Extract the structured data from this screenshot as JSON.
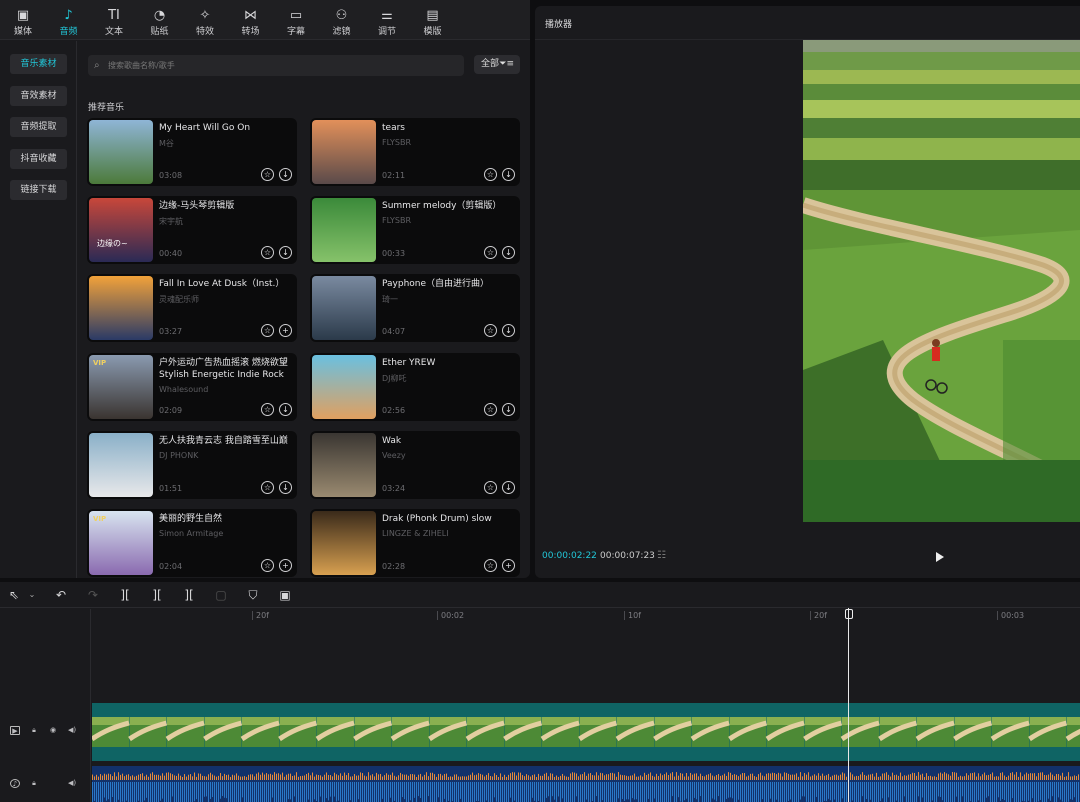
{
  "toolbar": {
    "tabs": [
      {
        "label": "媒体",
        "icon": "media-icon"
      },
      {
        "label": "音频",
        "icon": "audio-icon"
      },
      {
        "label": "文本",
        "icon": "text-icon"
      },
      {
        "label": "贴纸",
        "icon": "sticker-icon"
      },
      {
        "label": "特效",
        "icon": "effects-icon"
      },
      {
        "label": "转场",
        "icon": "transition-icon"
      },
      {
        "label": "字幕",
        "icon": "subtitle-icon"
      },
      {
        "label": "滤镜",
        "icon": "filter-icon"
      },
      {
        "label": "调节",
        "icon": "adjust-icon"
      },
      {
        "label": "模版",
        "icon": "template-icon"
      }
    ],
    "active": "音频"
  },
  "sidebar": {
    "items": [
      "音乐素材",
      "音效素材",
      "音频提取",
      "抖音收藏",
      "链接下载"
    ],
    "active": "音乐素材"
  },
  "search": {
    "placeholder": "搜索歌曲名称/歌手"
  },
  "filter": {
    "label": "全部"
  },
  "section_title": "推荐音乐",
  "tracks": [
    {
      "title": "My Heart Will Go On",
      "artist": "M谷",
      "duration": "03:08",
      "action": "download"
    },
    {
      "title": "tears",
      "artist": "FLYSBR",
      "duration": "02:11",
      "action": "download"
    },
    {
      "title": "边缘-马头琴剪辑版",
      "artist": "宋宇航",
      "duration": "00:40",
      "action": "download"
    },
    {
      "title": "Summer melody（剪辑版）",
      "artist": "FLYSBR",
      "duration": "00:33",
      "action": "download"
    },
    {
      "title": "Fall In Love At Dusk（Inst.）",
      "artist": "灵魂配乐师",
      "duration": "03:27",
      "action": "add"
    },
    {
      "title": "Payphone（自由进行曲）",
      "artist": "琦一",
      "duration": "04:07",
      "action": "download"
    },
    {
      "title": "户外运动广告热血摇滚 燃烧欲望\nStylish Energetic Indie Rock",
      "artist": "Whalesound",
      "duration": "02:09",
      "action": "download"
    },
    {
      "title": "Ether YREW",
      "artist": "DJ柳吒",
      "duration": "02:56",
      "action": "download"
    },
    {
      "title": "无人扶我青云志 我自踏雪至山巅",
      "artist": "DJ PHONK",
      "duration": "01:51",
      "action": "download"
    },
    {
      "title": "Wak",
      "artist": "Veezy",
      "duration": "03:24",
      "action": "download"
    },
    {
      "title": "美丽的野生自然",
      "artist": "Simon Armitage",
      "duration": "02:04",
      "action": "add"
    },
    {
      "title": "Drak (Phonk Drum) slow",
      "artist": "LINGZE & ZIHELI",
      "duration": "02:28",
      "action": "add"
    }
  ],
  "thumb_text": {
    "card3": "边缘の~",
    "vip": "VIP"
  },
  "player": {
    "title": "播放器",
    "current_time": "00:00:02:22",
    "total_time": "00:00:07:23"
  },
  "ruler": {
    "ticks": [
      "20f",
      "00:02",
      "10f",
      "20f",
      "00:03"
    ]
  },
  "colors": {
    "accent": "#22c7d8",
    "video_track": "#0f6464",
    "audio_track": "#12316a"
  }
}
